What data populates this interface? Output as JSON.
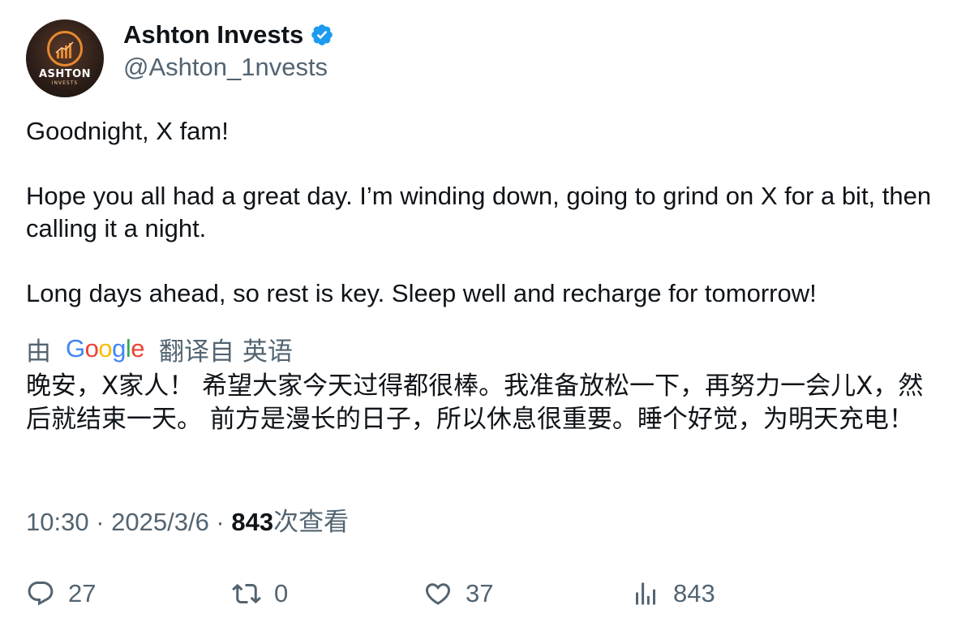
{
  "author": {
    "display_name": "Ashton Invests",
    "handle": "@Ashton_1nvests",
    "avatar_text_main": "ASHTON",
    "avatar_text_sub": "INVESTS",
    "verified_icon": "verified-badge-icon",
    "verified_color": "#1d9bf0"
  },
  "tweet": {
    "line1": "Goodnight, X fam!",
    "line2": "Hope you all had a great day. I’m winding down, going to grind on X for a bit, then calling it a night.",
    "line3": "Long days ahead, so rest is key. Sleep well and recharge for tomorrow!"
  },
  "translation": {
    "prefix": "由",
    "provider": "Google",
    "suffix": "翻译自 英语",
    "text": "晚安，X家人！ 希望大家今天过得都很棒。我准备放松一下，再努力一会儿X，然后就结束一天。 前方是漫长的日子，所以休息很重要。睡个好觉，为明天充电！"
  },
  "meta": {
    "time": "10:30",
    "separator": " · ",
    "date": "2025/3/6",
    "views_count": "843",
    "views_label": "次查看"
  },
  "actions": {
    "reply_count": "27",
    "retweet_count": "0",
    "like_count": "37",
    "view_count": "843"
  },
  "colors": {
    "text_primary": "#0f1419",
    "text_secondary": "#536471",
    "avatar_accent": "#e8892e"
  }
}
